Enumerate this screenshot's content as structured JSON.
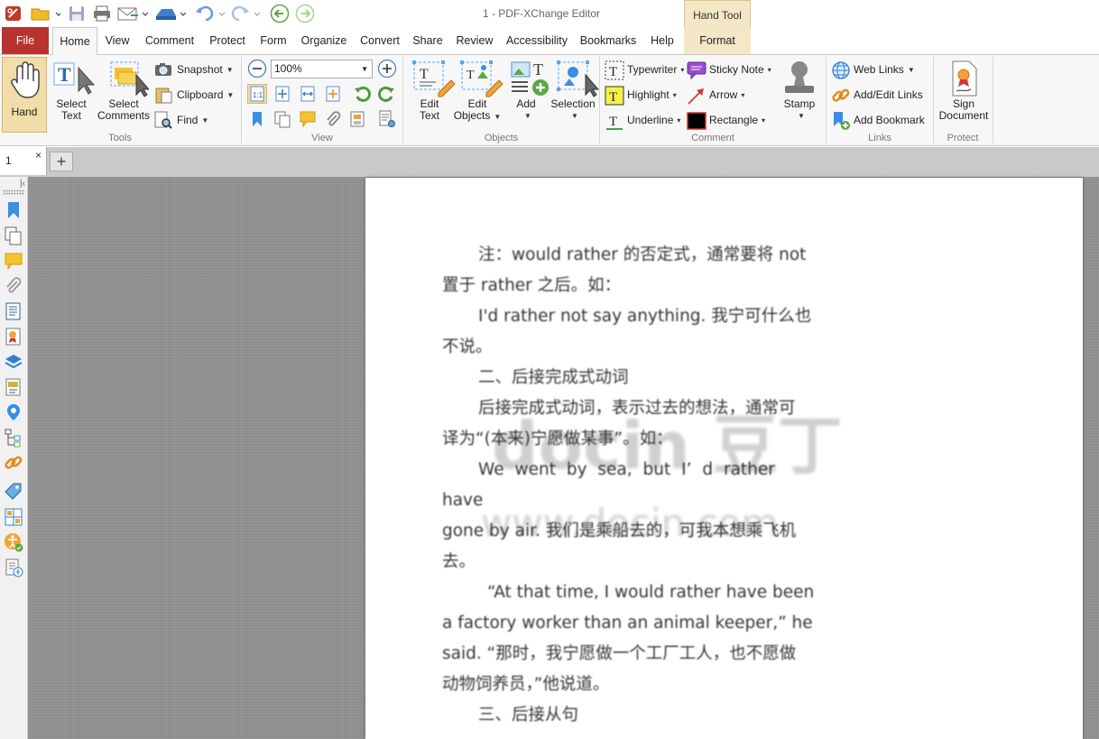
{
  "window": {
    "title": "1 - PDF-XChange Editor",
    "context_tab_title": "Hand Tool"
  },
  "ribbon_tabs": [
    "File",
    "Home",
    "View",
    "Comment",
    "Protect",
    "Form",
    "Organize",
    "Convert",
    "Share",
    "Review",
    "Accessibility",
    "Bookmarks",
    "Help",
    "Format"
  ],
  "tools": {
    "hand": "Hand",
    "select_text": [
      "Select",
      "Text"
    ],
    "select_comments": [
      "Select",
      "Comments"
    ],
    "snapshot": "Snapshot",
    "clipboard": "Clipboard",
    "find": "Find",
    "label": "Tools"
  },
  "view": {
    "zoom": "100%",
    "label": "View"
  },
  "objects": {
    "edit_text": [
      "Edit",
      "Text"
    ],
    "edit_objects": [
      "Edit",
      "Objects"
    ],
    "add": "Add",
    "selection": "Selection",
    "label": "Objects"
  },
  "comment": {
    "typewriter": "Typewriter",
    "sticky_note": "Sticky Note",
    "highlight": "Highlight",
    "arrow": "Arrow",
    "underline": "Underline",
    "rectangle": "Rectangle",
    "stamp": "Stamp",
    "label": "Comment"
  },
  "links": {
    "web_links": "Web Links",
    "add_edit_links": "Add/Edit Links",
    "add_bookmark": "Add Bookmark",
    "label": "Links"
  },
  "protect": {
    "sign": [
      "Sign",
      "Document"
    ],
    "label": "Protect"
  },
  "doc_tab": {
    "name": "1",
    "close": "×",
    "new": "+"
  },
  "document": {
    "paragraphs": [
      "注：would rather 的否定式，通常要将 not",
      "置于 rather 之后。如：",
      "I'd rather not say anything. 我宁可什么也",
      "不说。",
      "二、后接完成式动词",
      "后接完成式动词，表示过去的想法，通常可",
      "译为“(本来)宁愿做某事”。如：",
      "We went by sea, but I’ d rather have",
      "gone by air. 我们是乘船去的，可我本想乘飞机",
      "去。",
      "“At that time, I would rather have been",
      "a factory worker than an animal keeper,”  he",
      "said. “那时，我宁愿做一个工厂工人，也不愿做",
      "动物饲养员，”他说道。",
      "三、后接从句"
    ],
    "watermark_1": "docin 豆丁",
    "watermark_2": "www.docin.com"
  }
}
